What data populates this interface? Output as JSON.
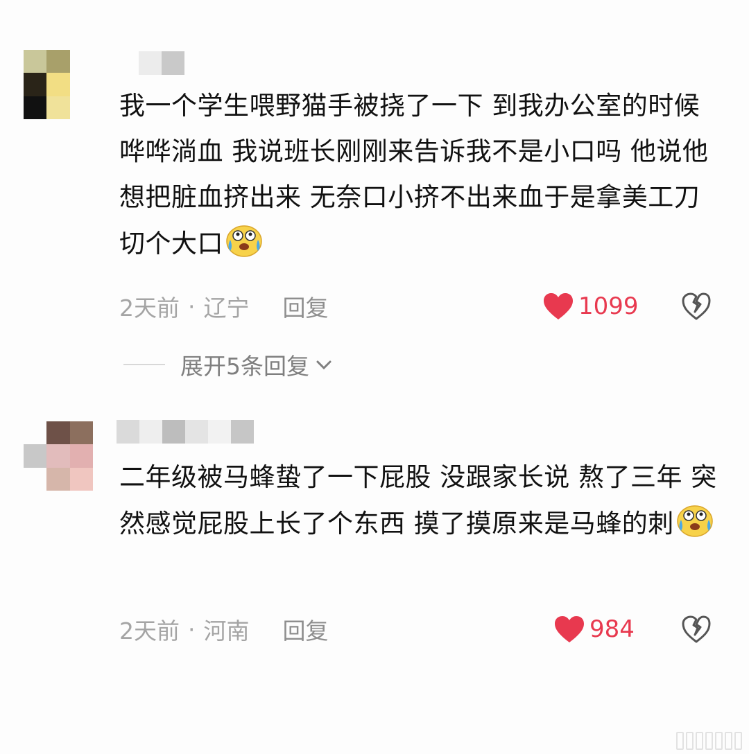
{
  "comments": [
    {
      "text": "我一个学生喂野猫手被挠了一下 到我办公室的时候哗哗淌血 我说班长刚刚来告诉我不是小口吗 他说他想把脏血挤出来 无奈口小挤不出来血于是拿美工刀切个大口",
      "emoji": "crying-laughing-emoji",
      "time": "2天前",
      "separator": "·",
      "location": "辽宁",
      "reply_label": "回复",
      "likes": "1099"
    },
    {
      "text": "二年级被马蜂蛰了一下屁股 没跟家长说 熬了三年 突然感觉屁股上长了个东西 摸了摸原来是马蜂的刺",
      "emoji": "crying-laughing-emoji",
      "time": "2天前",
      "separator": "·",
      "location": "河南",
      "reply_label": "回复",
      "likes": "984"
    }
  ],
  "expand_replies_label": "展开5条回复",
  "colors": {
    "like_red": "#e8394f",
    "meta_gray": "#a4a4a4",
    "text": "#111111",
    "background": "#fdfdfd"
  },
  "icons": [
    "heart-icon",
    "broken-heart-icon",
    "chevron-down-icon"
  ]
}
